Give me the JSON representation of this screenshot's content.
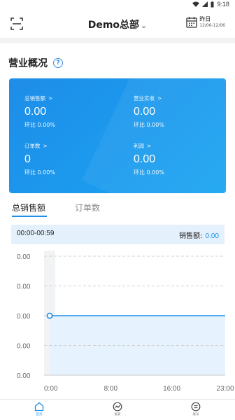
{
  "status_bar": {
    "time": "9:18"
  },
  "header": {
    "title": "Demo总部",
    "date_label": "昨日",
    "date_range": "12/06-12/06"
  },
  "overview": {
    "title": "营业概况",
    "help": "?",
    "metrics": [
      {
        "label": "总销售额",
        "value": "0.00",
        "ratio": "环比 0.00%"
      },
      {
        "label": "营业实收",
        "value": "0.00",
        "ratio": "环比 0.00%"
      },
      {
        "label": "订单数",
        "value": "0",
        "ratio": "环比 0.00%"
      },
      {
        "label": "利润",
        "value": "0.00",
        "ratio": "环比 0.00%"
      }
    ]
  },
  "tabs": [
    {
      "label": "总销售额",
      "active": true
    },
    {
      "label": "订单数",
      "active": false
    }
  ],
  "range_bar": {
    "time": "00:00-00:59",
    "sales_label": "销售额:",
    "sales_value": "0.00"
  },
  "chart_data": {
    "type": "area",
    "y_ticks": [
      "0.00",
      "0.00",
      "0.00",
      "0.00",
      "0.00"
    ],
    "x_ticks": [
      "0:00",
      "8:00",
      "16:00",
      "23:00"
    ],
    "x": [
      "0:00",
      "23:00"
    ],
    "series": [
      {
        "values": [
          0,
          0
        ]
      }
    ],
    "highlight": "0:00",
    "grid": true,
    "colors": {
      "line": "#1d8fe8",
      "fill": "#e6f2fd",
      "highlight": "#f2f3f5"
    }
  },
  "bottom_nav": [
    {
      "label": "首页",
      "icon": "home-icon",
      "active": true
    },
    {
      "label": "报表",
      "icon": "report-icon",
      "active": false
    },
    {
      "label": "账号",
      "icon": "account-icon",
      "active": false
    }
  ]
}
